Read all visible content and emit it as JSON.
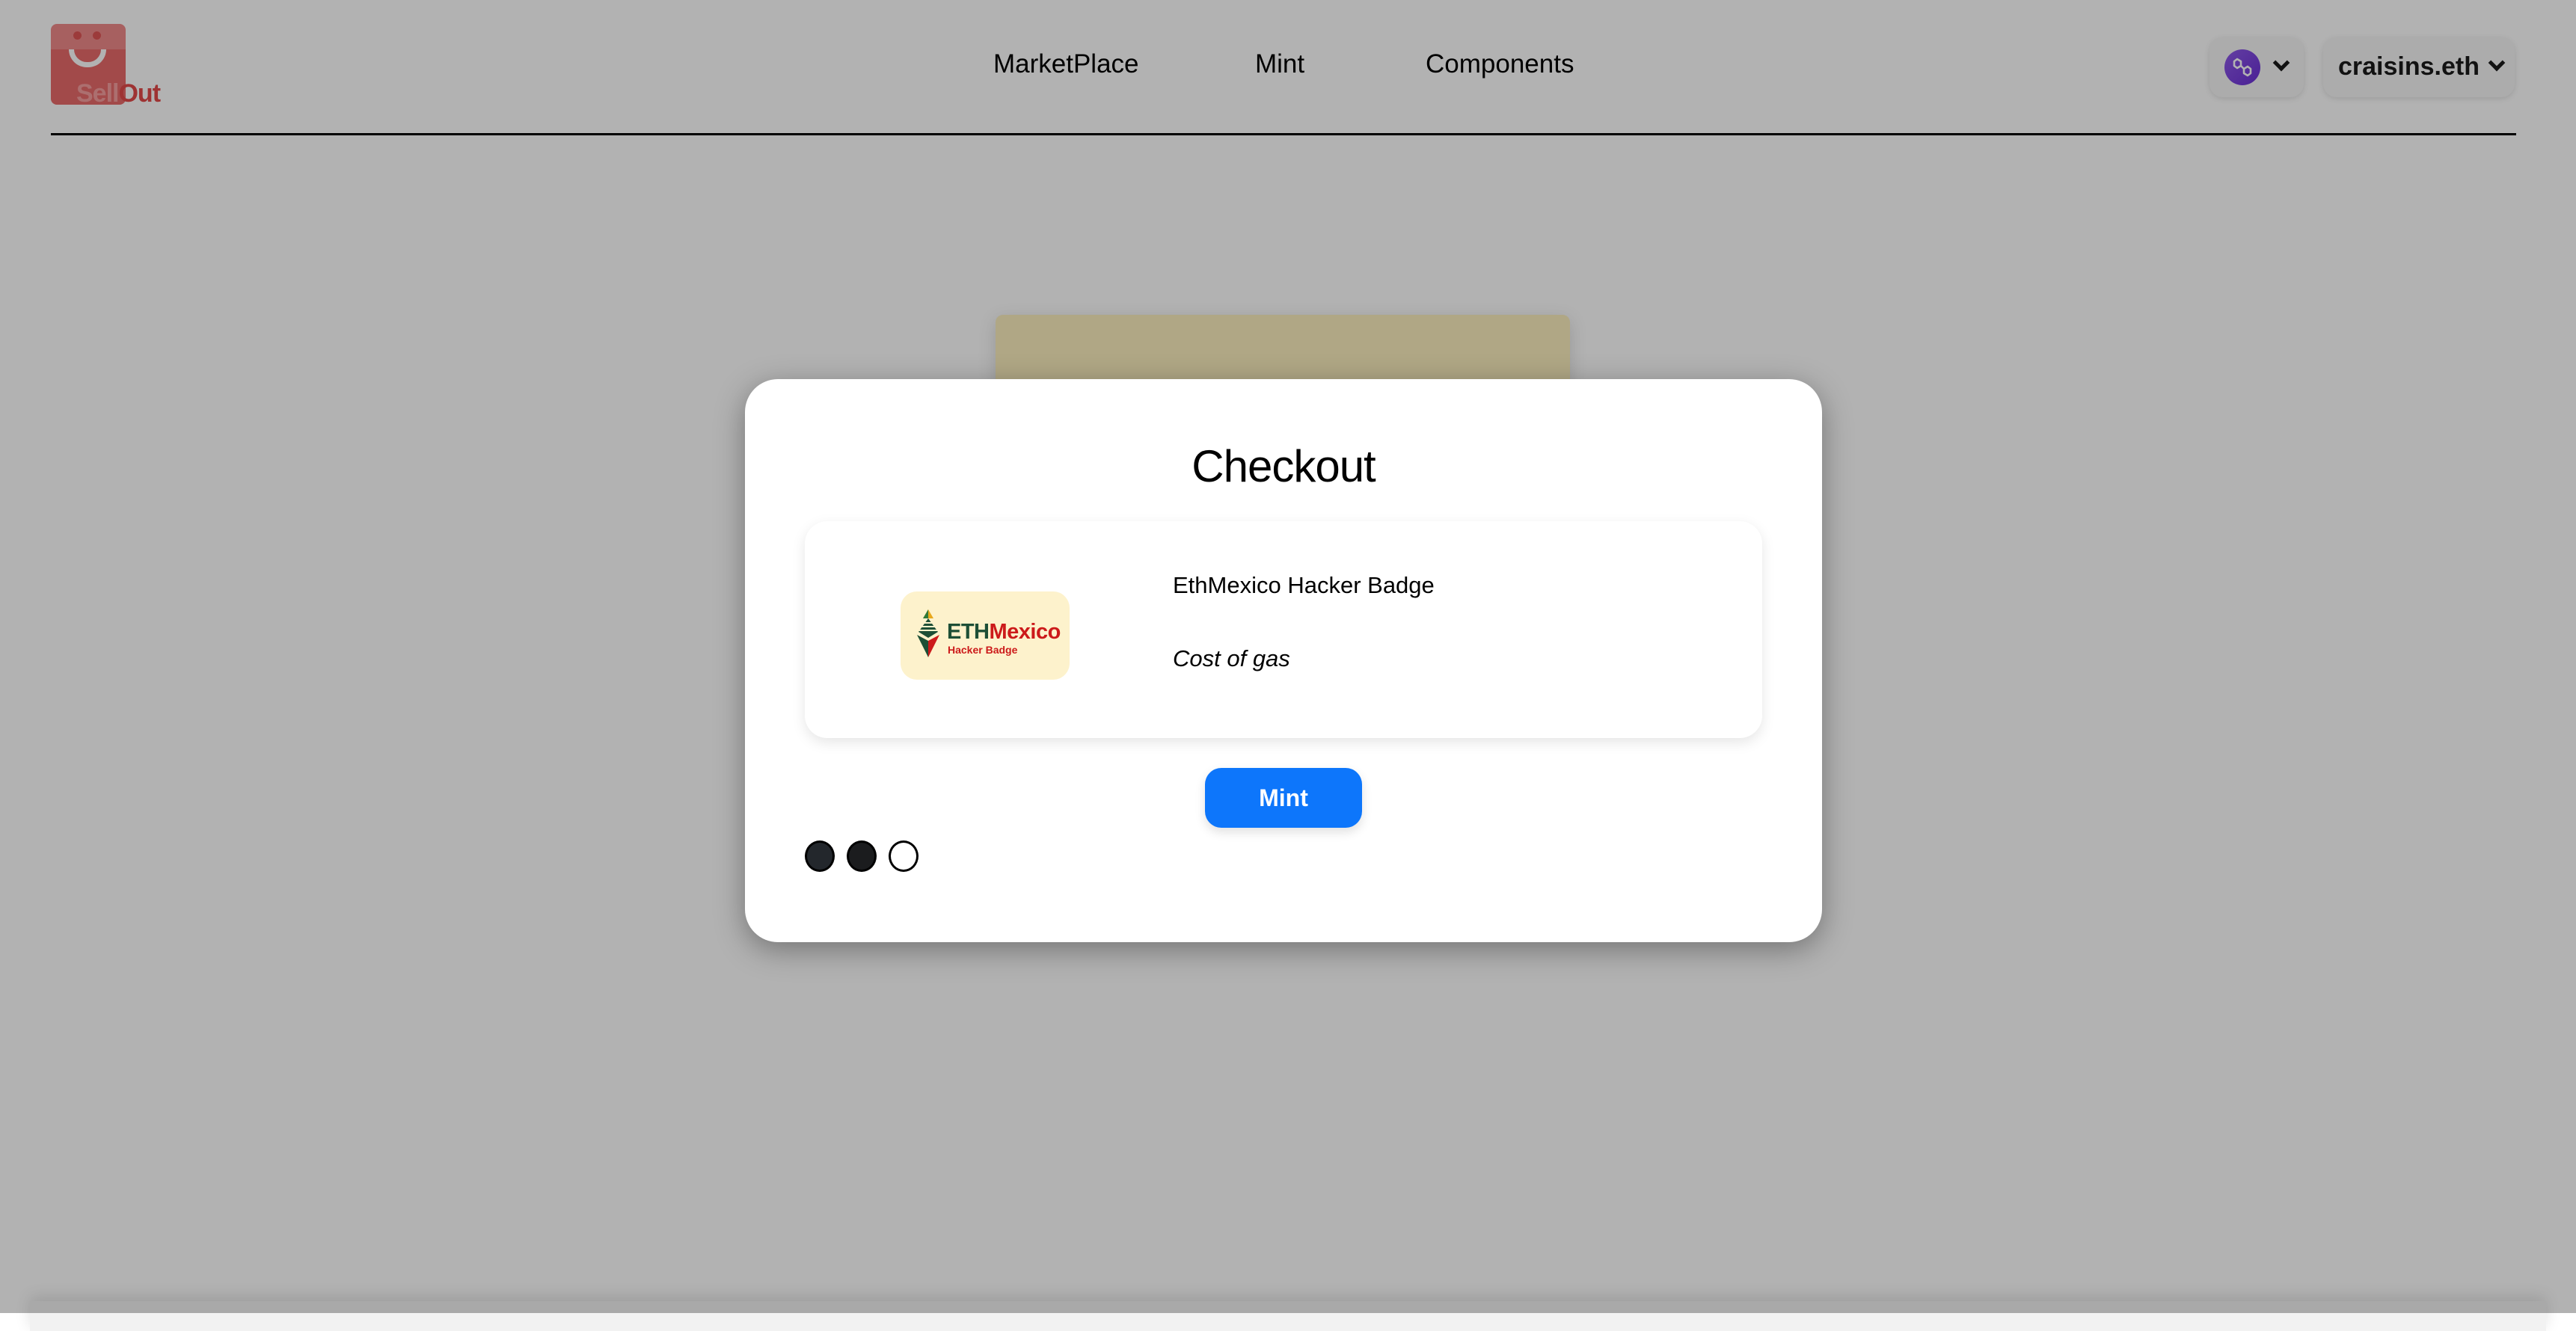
{
  "header": {
    "logo": {
      "text_part1": "Sell",
      "text_part2": "Out",
      "icon": "shopping-bag-smile-icon"
    },
    "nav": [
      {
        "label": "MarketPlace"
      },
      {
        "label": "Mint"
      },
      {
        "label": "Components"
      }
    ],
    "network": {
      "icon": "polygon-icon",
      "chevron": "chevron-down-icon"
    },
    "account": {
      "name": "craisins.eth",
      "chevron": "chevron-down-icon"
    }
  },
  "modal": {
    "title": "Checkout",
    "item": {
      "name": "EthMexico Hacker Badge",
      "price_label": "Cost of gas",
      "image": {
        "logo_eth": "ETH",
        "logo_mexico": "Mexico",
        "logo_sub": "Hacker Badge"
      }
    },
    "mint_button_label": "Mint",
    "steps": [
      {
        "state": "completed"
      },
      {
        "state": "completed"
      },
      {
        "state": "pending"
      }
    ]
  },
  "colors": {
    "primary_button": "#0d76fb",
    "brand_red": "#e24a4a",
    "polygon_purple": "#7b3fe4",
    "badge_background": "#fdf2cc"
  }
}
